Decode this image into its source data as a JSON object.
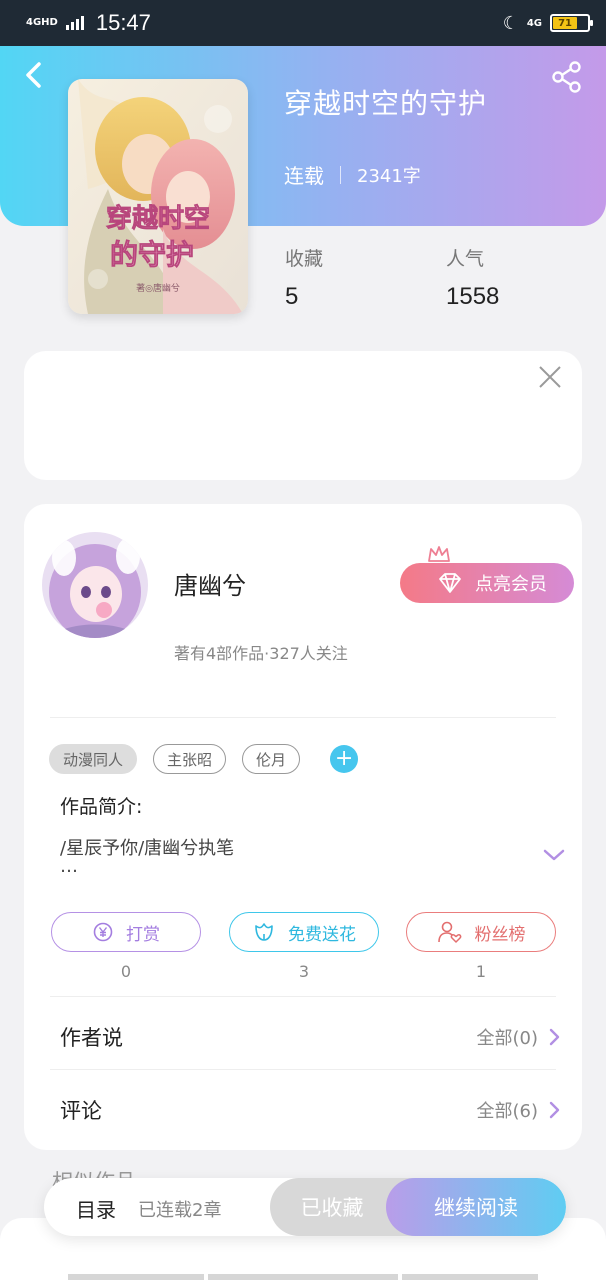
{
  "status_bar": {
    "network": "4GHD",
    "time": "15:47",
    "network_right": "4G",
    "battery": "71"
  },
  "book": {
    "title": "穿越时空的守护",
    "status": "连载",
    "word_count": "2341字",
    "cover_title_line1": "穿越时空",
    "cover_title_line2": "的守护",
    "cover_author": "著◎唐幽兮"
  },
  "stats": [
    {
      "label": "收藏",
      "value": "5"
    },
    {
      "label": "人气",
      "value": "1558"
    }
  ],
  "author": {
    "name": "唐幽兮",
    "info": "著有4部作品·327人关注",
    "vip_button": "点亮会员"
  },
  "tags": [
    "动漫同人",
    "主张昭",
    "伦月"
  ],
  "intro": {
    "label": "作品简介:",
    "text": "/星辰予你/唐幽兮执笔",
    "more": "…"
  },
  "actions": [
    {
      "label": "打赏",
      "count": "0"
    },
    {
      "label": "免费送花",
      "count": "3"
    },
    {
      "label": "粉丝榜",
      "count": "1"
    }
  ],
  "sections": [
    {
      "label": "作者说",
      "right": "全部(0)"
    },
    {
      "label": "评论",
      "right": "全部(6)"
    }
  ],
  "similar_title": "相似作品",
  "bottom_bar": {
    "toc": "目录",
    "serial": "已连载2章",
    "collected": "已收藏",
    "read": "继续阅读"
  },
  "colors": {
    "hero_start": "#52d6f4",
    "hero_end": "#c49ae9",
    "accent_cyan": "#46c6ee",
    "vip_start": "#f47a87",
    "vip_end": "#d58bd6"
  },
  "icons": [
    "back-arrow-icon",
    "share-icon",
    "close-icon",
    "crown-icon",
    "diamond-icon",
    "plus-icon",
    "chevron-down-icon",
    "yen-coin-icon",
    "flower-icon",
    "user-heart-icon",
    "chevron-right-icon"
  ]
}
